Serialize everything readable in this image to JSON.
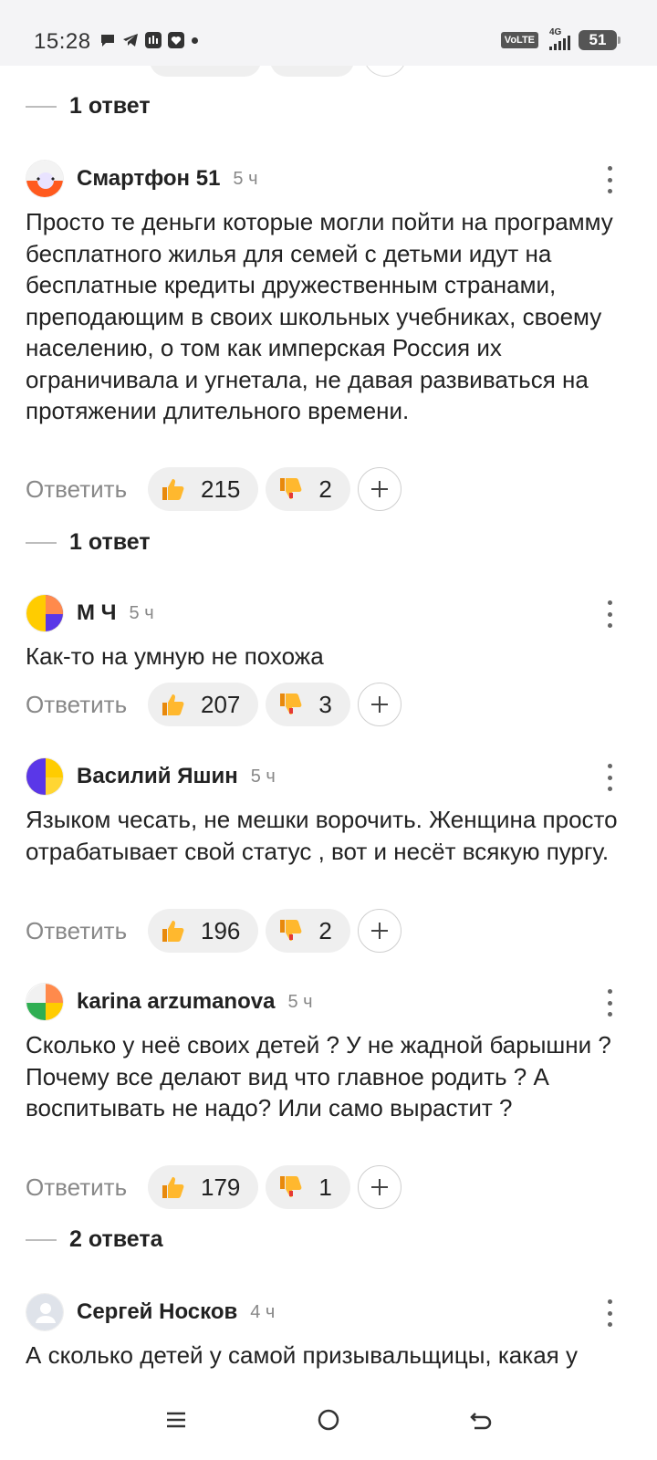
{
  "status_bar": {
    "time": "15:28",
    "volte": "VoLTE",
    "network": "4G",
    "battery": "51"
  },
  "thread": {
    "top_replies_label": "1 ответ",
    "reply_label": "Ответить",
    "comments": [
      {
        "author": "Смартфон 51",
        "time": "5 ч",
        "text": "Просто те деньги которые могли пойти на программу бесплатного жилья для семей с детьми идут на бесплатные кредиты дружественным странами, преподающим в своих школьных учебниках, своему населению, о том как имперская Россия их ограничивала и угнетала, не давая развиваться на протяжении длительного времени.",
        "likes": "215",
        "dislikes": "2",
        "replies_label": "1 ответ"
      },
      {
        "author": "М Ч",
        "time": "5 ч",
        "text": "Как-то на умную не похожа",
        "likes": "207",
        "dislikes": "3"
      },
      {
        "author": "Василий Яшин",
        "time": "5 ч",
        "text": "Языком чесать, не мешки ворочить. Женщина просто отрабатывает свой статус , вот и несёт всякую пургу.",
        "likes": "196",
        "dislikes": "2"
      },
      {
        "author": "karina arzumanova",
        "time": "5 ч",
        "text": "Сколько у неё своих детей ? У не жадной барышни ? Почему все делают вид что главное родить ? А воспитывать не надо? Или само вырастит ?",
        "likes": "179",
        "dislikes": "1",
        "replies_label": "2 ответа"
      },
      {
        "author": "Сергей Носков",
        "time": "4 ч",
        "text": "А сколько детей у самой призывальщицы, какая у"
      }
    ]
  },
  "icons": {
    "like": "thumbs-up-icon",
    "dislike": "thumbs-down-icon",
    "add_reaction": "plus-icon",
    "more": "more-vertical-icon",
    "nav_menu": "menu-icon",
    "nav_home": "home-circle-icon",
    "nav_back": "back-icon"
  }
}
